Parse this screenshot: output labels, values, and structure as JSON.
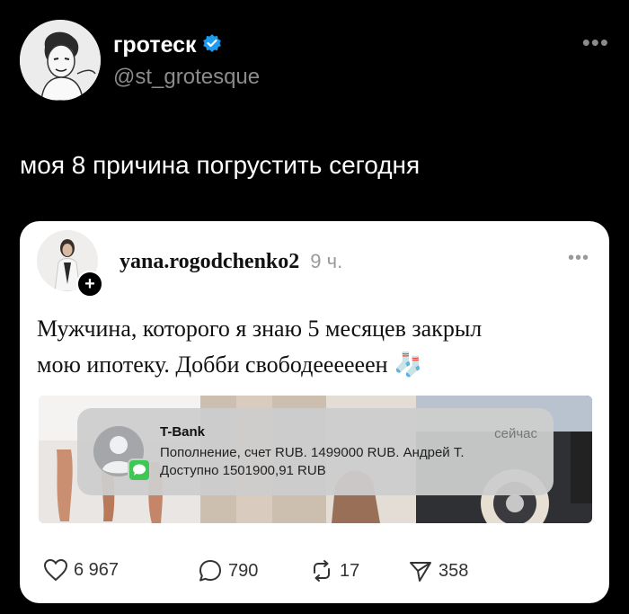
{
  "tweet": {
    "display_name": "гротеск",
    "handle": "@st_grotesque",
    "text": "моя 8 причина погрустить сегодня",
    "more_icon": "more-horizontal-icon",
    "verified_icon": "verified-badge-icon"
  },
  "embedded_post": {
    "username": "yana.rogodchenko2",
    "time": "9 ч.",
    "text_line1": "Мужчина, которого я знаю 5 месяцев закрыл",
    "text_line2": "мою ипотеку. Добби свободеееееен",
    "emoji": "🧦",
    "notification": {
      "title": "T-Bank",
      "time": "сейчас",
      "line1": "Пополнение, счет RUB. 1499000 RUB. Андрей Т.",
      "line2": "Доступно 1501900,91 RUB"
    },
    "actions": {
      "likes": "6 967",
      "comments": "790",
      "reposts": "17",
      "shares": "358"
    }
  },
  "colors": {
    "background": "#000000",
    "card": "#ffffff",
    "verified": "#1d9bf0",
    "muted": "#8b8b8b"
  }
}
